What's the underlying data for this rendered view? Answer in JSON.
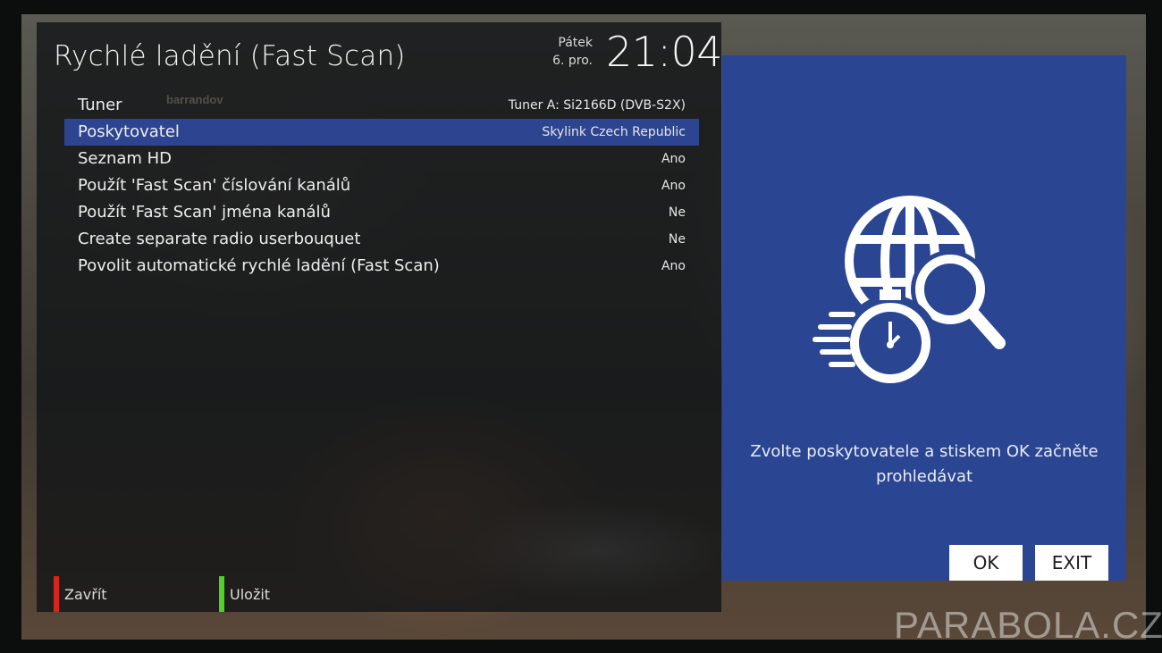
{
  "screen": {
    "title": "Rychlé ladění (Fast Scan)",
    "clock": {
      "day": "Pátek",
      "date": "6. pro.",
      "time": "21:04"
    }
  },
  "settings": [
    {
      "label": "Tuner",
      "value": "Tuner A: Si2166D (DVB-S2X)",
      "selected": false
    },
    {
      "label": "Poskytovatel",
      "value": "Skylink Czech Republic",
      "selected": true
    },
    {
      "label": "Seznam HD",
      "value": "Ano",
      "selected": false
    },
    {
      "label": "Použít 'Fast Scan' číslování kanálů",
      "value": "Ano",
      "selected": false
    },
    {
      "label": "Použít 'Fast Scan' jména kanálů",
      "value": "Ne",
      "selected": false
    },
    {
      "label": "Create separate radio userbouquet",
      "value": "Ne",
      "selected": false
    },
    {
      "label": "Povolit automatické rychlé ladění (Fast Scan)",
      "value": "Ano",
      "selected": false
    }
  ],
  "footer": {
    "red": {
      "label": "Zavřít",
      "color": "#d8251b"
    },
    "green": {
      "label": "Uložit",
      "color": "#4fd12a"
    }
  },
  "info": {
    "icon": "globe-stopwatch-search-icon",
    "text": "Zvolte poskytovatele a stiskem OK začněte prohledávat",
    "ok_label": "OK",
    "exit_label": "EXIT"
  },
  "overlay": {
    "channel_logo": "barrandov",
    "watermark": "PARABOLA.CZ"
  },
  "colors": {
    "accent": "#2d4490",
    "info_panel": "#2a4591",
    "panel_bg": "#121416"
  }
}
